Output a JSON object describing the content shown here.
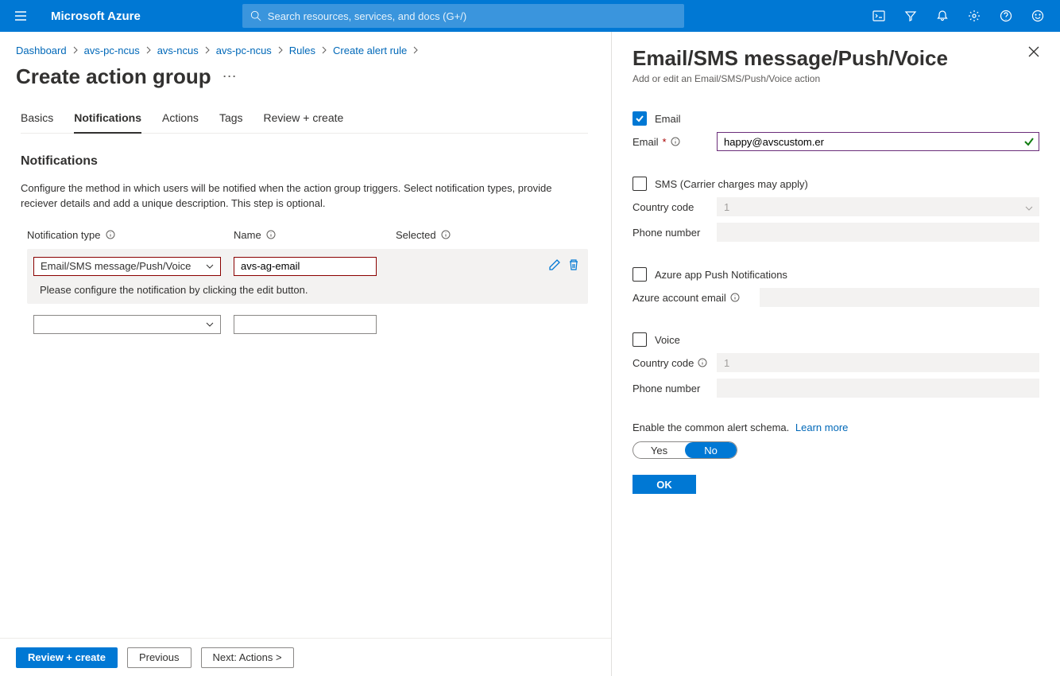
{
  "header": {
    "brand": "Microsoft Azure",
    "search_placeholder": "Search resources, services, and docs (G+/)"
  },
  "breadcrumb": [
    "Dashboard",
    "avs-pc-ncus",
    "avs-ncus",
    "avs-pc-ncus",
    "Rules",
    "Create alert rule"
  ],
  "page_title": "Create action group",
  "tabs": [
    "Basics",
    "Notifications",
    "Actions",
    "Tags",
    "Review + create"
  ],
  "active_tab": "Notifications",
  "section": {
    "title": "Notifications",
    "description": "Configure the method in which users will be notified when the action group triggers. Select notification types, provide reciever details and add a unique description. This step is optional.",
    "col_type": "Notification type",
    "col_name": "Name",
    "col_selected": "Selected",
    "row1_type": "Email/SMS message/Push/Voice",
    "row1_name": "avs-ag-email",
    "row1_warning": "Please configure the notification by clicking the edit button."
  },
  "footer": {
    "review": "Review + create",
    "previous": "Previous",
    "next": "Next: Actions >"
  },
  "panel": {
    "title": "Email/SMS message/Push/Voice",
    "subtitle": "Add or edit an Email/SMS/Push/Voice action",
    "email_check": "Email",
    "email_label": "Email",
    "email_value": "happy@avscustom.er",
    "sms_check": "SMS (Carrier charges may apply)",
    "country_code_label": "Country code",
    "country_code_value": "1",
    "phone_label": "Phone number",
    "push_check": "Azure app Push Notifications",
    "push_email_label": "Azure account email",
    "voice_check": "Voice",
    "schema_text": "Enable the common alert schema.",
    "schema_link": "Learn more",
    "toggle_yes": "Yes",
    "toggle_no": "No",
    "ok": "OK"
  }
}
